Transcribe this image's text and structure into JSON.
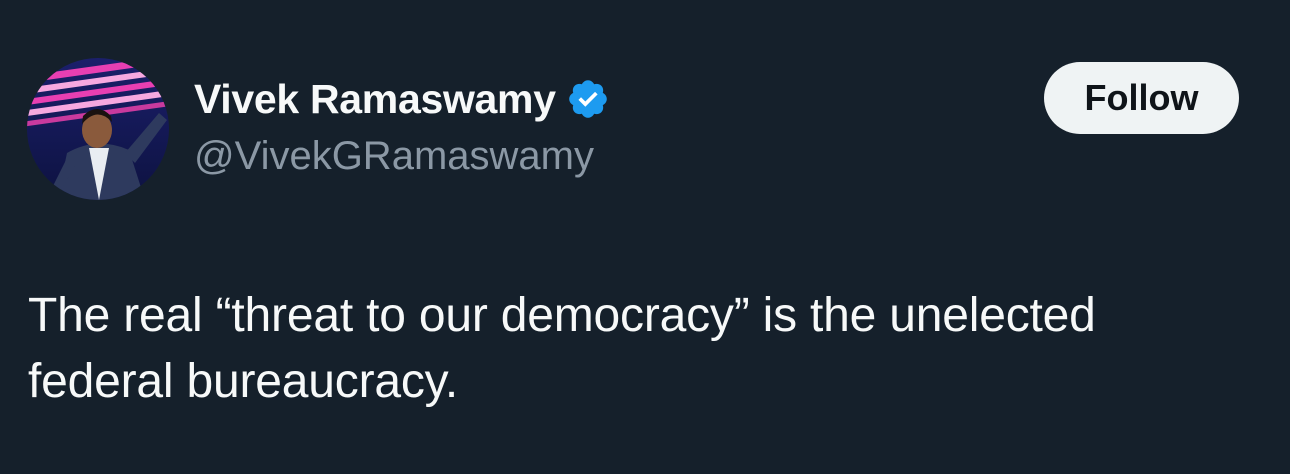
{
  "post": {
    "author": {
      "display_name": "Vivek Ramaswamy",
      "handle": "@VivekGRamaswamy",
      "verified": true,
      "verified_color": "#1d9bf0"
    },
    "follow_label": "Follow",
    "text": "The real “threat to our democracy” is the unelected\nfederal bureaucracy."
  },
  "theme": {
    "background": "#15202b",
    "text_primary": "#f7f9f9",
    "text_secondary": "#8b98a5",
    "button_bg": "#eff3f4"
  },
  "icons": {
    "verified": "verified-badge-icon",
    "avatar": "profile-photo"
  }
}
